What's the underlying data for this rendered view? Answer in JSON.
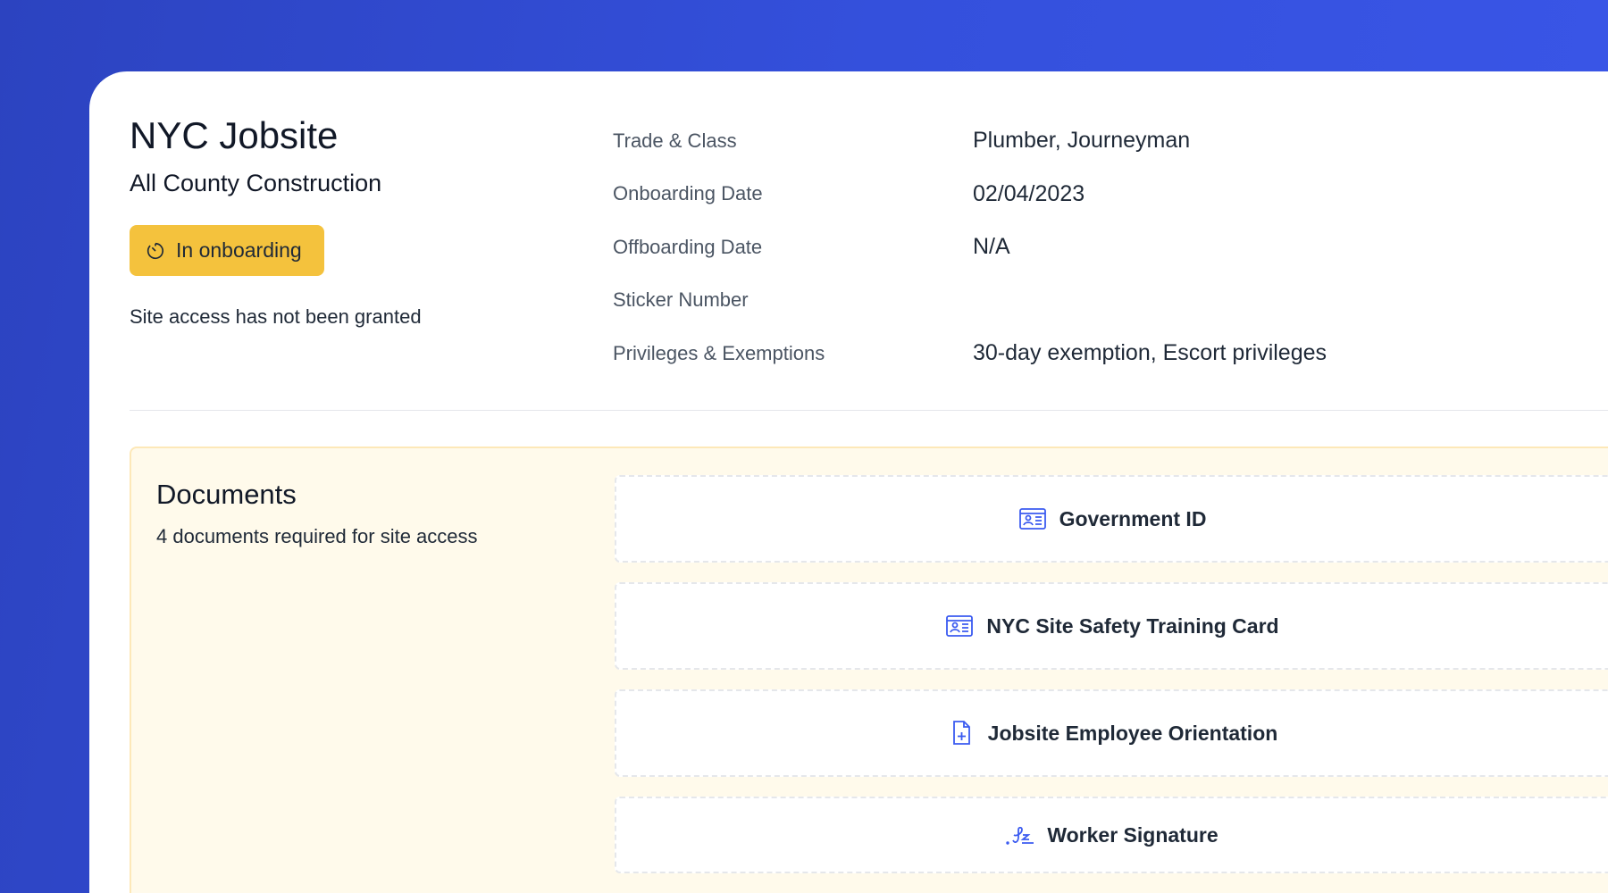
{
  "header": {
    "title": "NYC Jobsite",
    "company": "All County Construction",
    "status": "In onboarding",
    "access_note": "Site access has not been granted"
  },
  "details": [
    {
      "label": "Trade & Class",
      "value": "Plumber, Journeyman"
    },
    {
      "label": "Onboarding Date",
      "value": "02/04/2023"
    },
    {
      "label": "Offboarding Date",
      "value": "N/A"
    },
    {
      "label": "Sticker Number",
      "value": ""
    },
    {
      "label": "Privileges & Exemptions",
      "value": "30-day exemption, Escort privileges"
    }
  ],
  "documents": {
    "title": "Documents",
    "subtitle": "4 documents required for site access",
    "items": [
      {
        "label": "Government ID",
        "icon": "id-card-icon"
      },
      {
        "label": "NYC Site Safety Training Card",
        "icon": "id-card-icon"
      },
      {
        "label": "Jobsite Employee Orientation",
        "icon": "file-plus-icon"
      },
      {
        "label": "Worker Signature",
        "icon": "signature-icon"
      }
    ]
  },
  "colors": {
    "accent": "#3b5bf0",
    "badge": "#f4c23d",
    "panel": "#fffaeb"
  }
}
